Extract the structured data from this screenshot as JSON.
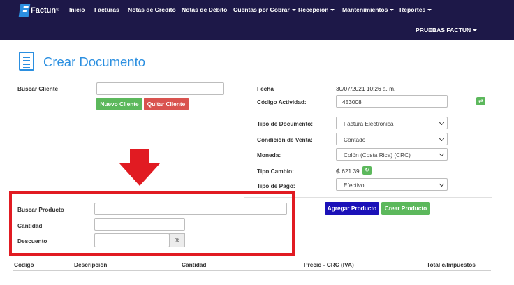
{
  "nav": {
    "logo": "Factun",
    "logo_reg": "®",
    "items": [
      "Inicio",
      "Facturas",
      "Notas de Crédito",
      "Notas de Débito",
      "Cuentas por Cobrar",
      "Recepción",
      "Mantenimientos",
      "Reportes"
    ],
    "user": "PRUEBAS FACTUN"
  },
  "page": {
    "title": "Crear Documento"
  },
  "cliente": {
    "label": "Buscar Cliente",
    "value": "",
    "nuevo_btn": "Nuevo Cliente",
    "quitar_btn": "Quitar Cliente"
  },
  "doc": {
    "fecha_label": "Fecha",
    "fecha_value": "30/07/2021 10:26 a. m.",
    "actividad_label": "Código Actividad:",
    "actividad_value": "453008",
    "tipo_doc_label": "Tipo de Documento:",
    "tipo_doc_value": "Factura Electrónica",
    "condicion_label": "Condición de Venta:",
    "condicion_value": "Contado",
    "moneda_label": "Moneda:",
    "moneda_value": "Colón (Costa Rica) (CRC)",
    "tipo_cambio_label": "Tipo Cambio:",
    "tipo_cambio_value": "₡ 621.39",
    "tipo_pago_label": "Tipo de Pago:",
    "tipo_pago_value": "Efectivo"
  },
  "producto": {
    "buscar_label": "Buscar Producto",
    "cantidad_label": "Cantidad",
    "descuento_label": "Descuento",
    "descuento_addon": "%",
    "agregar_btn": "Agregar Producto",
    "crear_btn": "Crear Producto"
  },
  "table": {
    "headers": [
      "Código",
      "Descripción",
      "Cantidad",
      "Precio - CRC (IVA)",
      "Total c/Impuestos"
    ]
  },
  "colors": {
    "navbar": "#1d1848",
    "accent": "#2b8fe0",
    "highlight": "#e11b22",
    "green": "#5cb85c",
    "red": "#d9534f",
    "navy_button": "#1b11b8"
  }
}
